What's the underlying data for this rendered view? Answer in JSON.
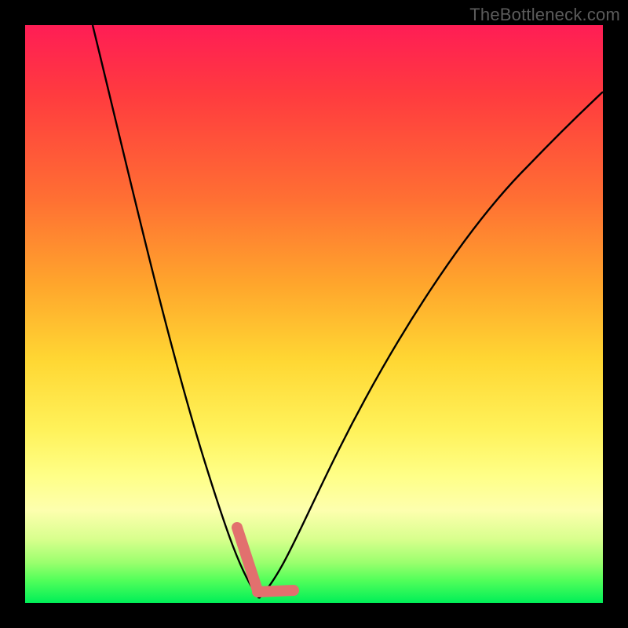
{
  "watermark": "TheBottleneck.com",
  "colors": {
    "frame": "#000000",
    "curve": "#000000",
    "marker": "#e2706e",
    "gradient_stops": [
      "#ff1d55",
      "#ff3b3f",
      "#ff6f33",
      "#ffa62c",
      "#ffd733",
      "#fff25a",
      "#ffff87",
      "#fdffae",
      "#d8ff8d",
      "#9bff6e",
      "#54ff5a",
      "#00ef58"
    ]
  },
  "chart_data": {
    "type": "line",
    "title": "",
    "xlabel": "",
    "ylabel": "",
    "xlim": [
      0,
      100
    ],
    "ylim": [
      0,
      100
    ],
    "grid": false,
    "legend_position": "none",
    "series": [
      {
        "name": "bottleneck-curve",
        "x": [
          12,
          14,
          16,
          18,
          20,
          22,
          24,
          26,
          28,
          30,
          32,
          34,
          36,
          38,
          40,
          42,
          44,
          46,
          50,
          54,
          58,
          62,
          66,
          70,
          74,
          78,
          82,
          86,
          90,
          94,
          98,
          100
        ],
        "values": [
          100,
          93,
          86,
          79,
          72,
          65,
          58,
          51,
          44,
          37,
          30,
          23,
          16,
          9,
          2,
          0,
          2,
          6,
          14,
          22,
          30,
          38,
          45,
          52,
          59,
          65,
          71,
          76,
          81,
          85,
          89,
          91
        ]
      }
    ],
    "annotations": [
      {
        "name": "highlight-marker",
        "shape": "v-tick",
        "x_range": [
          36,
          44
        ],
        "y_range": [
          0,
          14
        ]
      }
    ]
  }
}
